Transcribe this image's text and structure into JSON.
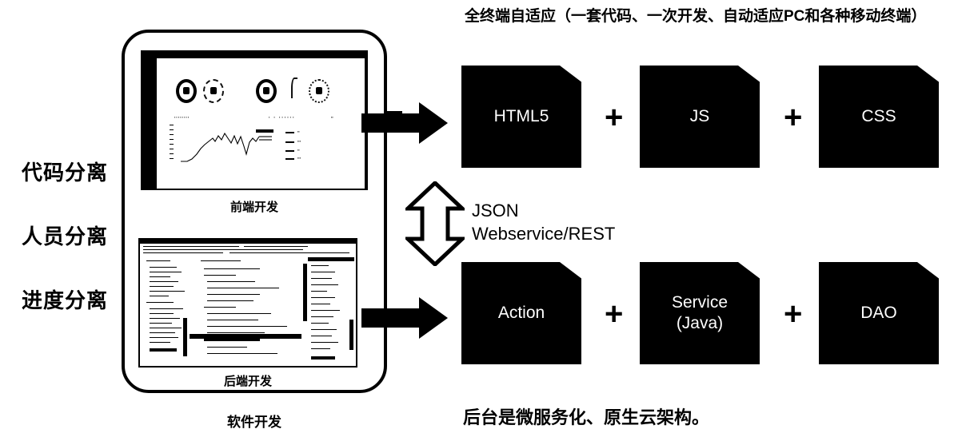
{
  "separation_labels": [
    {
      "text": "代码分离"
    },
    {
      "text": "人员分离"
    },
    {
      "text": "进度分离"
    }
  ],
  "device": {
    "caption": "软件开发",
    "front_end": {
      "caption": "前端开发",
      "screen_type": "dashboard-screenshot",
      "gauges": 5
    },
    "back_end": {
      "caption": "后端开发",
      "screen_type": "ide-screenshot"
    }
  },
  "arrows": {
    "top_arrow_name": "arrow-to-frontend-stack",
    "bottom_arrow_name": "arrow-to-backend-stack"
  },
  "right": {
    "title": "全终端自适应（一套代码、一次开发、自动适应PC和各种移动终端）",
    "frontend_row": [
      {
        "label": "HTML5"
      },
      {
        "label": "JS"
      },
      {
        "label": "CSS"
      }
    ],
    "backend_row": [
      {
        "label": "Action"
      },
      {
        "label": "Service\n(Java)"
      },
      {
        "label": "DAO"
      }
    ],
    "plus_symbol": "+",
    "middle": {
      "arrow_icon": "double-arrow-vertical-icon",
      "text": "JSON\nWebservice/REST"
    },
    "bottom_note": "后台是微服务化、原生云架构。"
  },
  "colors": {
    "background": "#ffffff",
    "foreground": "#000000",
    "card_bg": "#000000",
    "card_text": "#ffffff"
  }
}
